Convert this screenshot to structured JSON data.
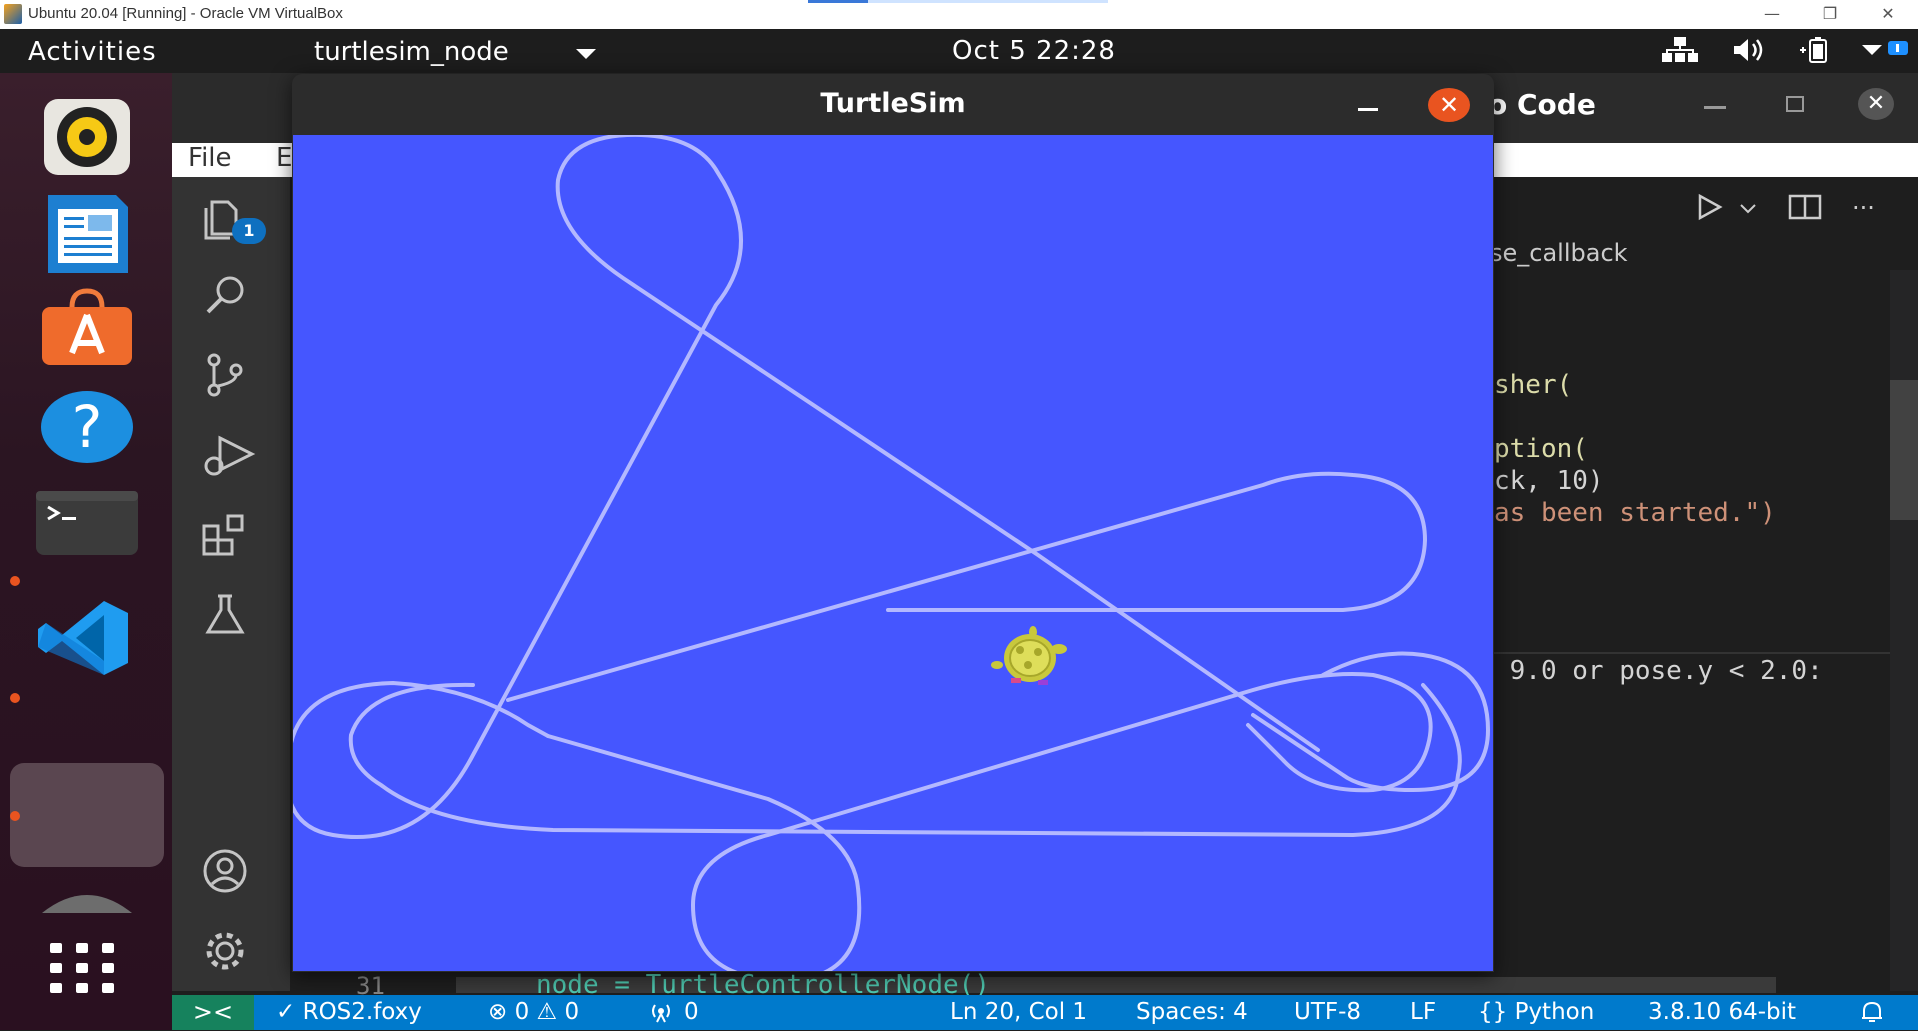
{
  "host": {
    "title": "Ubuntu 20.04 [Running] - Oracle VM VirtualBox",
    "controls": [
      "—",
      "❐",
      "✕"
    ]
  },
  "top_panel": {
    "activities": "Activities",
    "app_name": "turtlesim_node",
    "clock": "Oct 5  22:28"
  },
  "dock": {
    "items": [
      "rhythmbox",
      "libreoffice-writer",
      "ubuntu-software",
      "help",
      "terminal",
      "vscode",
      "active-window",
      "trash",
      "show-apps"
    ]
  },
  "turtlesim": {
    "title": "TurtleSim",
    "background": "#4556ff",
    "trail_color": "#b3b8ff"
  },
  "vscode": {
    "title_fragment": "o Code",
    "menu": {
      "file": "File",
      "edit": "E"
    },
    "badge": "1",
    "breadcrumb": "se_callback",
    "code_lines": [
      {
        "text": "sher(",
        "color": "#dcdcaa"
      },
      {
        "text": "ption(",
        "color": "#dcdcaa"
      },
      {
        "text": "ck, 10)",
        "color": "#d4d4d4"
      },
      {
        "text": "as been started.\")",
        "color": "#ce9178"
      },
      {
        "text": " 9.0 or pose.y < 2.0:",
        "color": "#d4d4d4"
      }
    ],
    "bottom_line_number": "31",
    "bottom_line_code": "node = TurtleControllerNode()",
    "statusbar": {
      "remote": "><",
      "workspace": "✓ ROS2.foxy",
      "problems": "⊗ 0 ⚠ 0",
      "ports": "0",
      "position": "Ln 20, Col 1",
      "spaces": "Spaces: 4",
      "encoding": "UTF-8",
      "eol": "LF",
      "language": "{} Python",
      "interpreter": "3.8.10 64-bit"
    }
  }
}
